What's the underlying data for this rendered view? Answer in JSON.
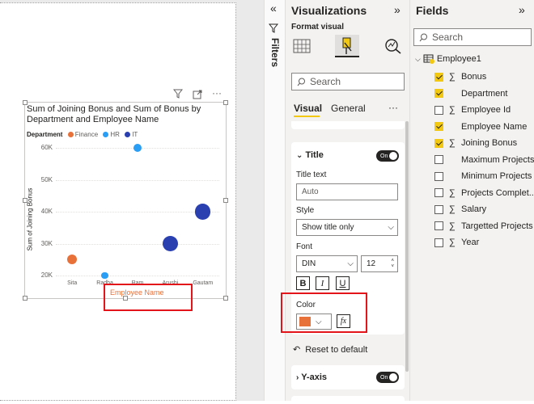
{
  "chart": {
    "title": "Sum of Joining Bonus and Sum of Bonus by Department and Employee Name",
    "legend_title": "Department",
    "legend": [
      {
        "name": "Finance",
        "color": "#e8713a"
      },
      {
        "name": "HR",
        "color": "#2a9df4"
      },
      {
        "name": "IT",
        "color": "#2a3fb0"
      }
    ],
    "y_title": "Sum of Joining Bonus",
    "x_title": "Employee Name",
    "y_ticks": [
      "60K",
      "50K",
      "40K",
      "30K",
      "20K"
    ],
    "x_ticks": [
      "Sita",
      "Radha",
      "Ram",
      "Arushi",
      "Gautam"
    ]
  },
  "chart_data": {
    "type": "scatter",
    "title": "Sum of Joining Bonus and Sum of Bonus by Department and Employee Name",
    "xlabel": "Employee Name",
    "ylabel": "Sum of Joining Bonus",
    "categories": [
      "Sita",
      "Radha",
      "Ram",
      "Arushi",
      "Gautam"
    ],
    "ylim": [
      20000,
      60000
    ],
    "series": [
      {
        "name": "Finance",
        "points": [
          {
            "x": "Sita",
            "y": 25000,
            "size": 1
          }
        ]
      },
      {
        "name": "HR",
        "points": [
          {
            "x": "Radha",
            "y": 20000,
            "size": 0.7
          },
          {
            "x": "Ram",
            "y": 60000,
            "size": 0.9
          }
        ]
      },
      {
        "name": "IT",
        "points": [
          {
            "x": "Arushi",
            "y": 30000,
            "size": 1.6
          },
          {
            "x": "Gautam",
            "y": 40000,
            "size": 1.6
          }
        ]
      }
    ]
  },
  "filters": {
    "label": "Filters",
    "icon": "chevron-left-icon"
  },
  "viz": {
    "title": "Visualizations",
    "subtitle": "Format visual",
    "search_placeholder": "Search",
    "tab_visual": "Visual",
    "tab_general": "General",
    "more": "···",
    "title_section": "Title",
    "toggle_on": "On",
    "title_text_label": "Title text",
    "title_text_value": "Auto",
    "style_label": "Style",
    "style_value": "Show title only",
    "font_label": "Font",
    "font_value": "DIN",
    "font_size": "12",
    "bold": "B",
    "italic": "I",
    "underline": "U",
    "color_label": "Color",
    "color_value": "#e8713a",
    "fx": "fx",
    "reset": "Reset to default",
    "yaxis": "Y-axis"
  },
  "fields": {
    "title": "Fields",
    "search_placeholder": "Search",
    "table": "Employee1",
    "items": [
      {
        "label": "Bonus",
        "checked": true,
        "sigma": true
      },
      {
        "label": "Department",
        "checked": true,
        "sigma": false
      },
      {
        "label": "Employee Id",
        "checked": false,
        "sigma": true
      },
      {
        "label": "Employee Name",
        "checked": true,
        "sigma": false
      },
      {
        "label": "Joining Bonus",
        "checked": true,
        "sigma": true
      },
      {
        "label": "Maximum Projects",
        "checked": false,
        "sigma": false
      },
      {
        "label": "Minimum Projects",
        "checked": false,
        "sigma": false
      },
      {
        "label": "Projects Complet...",
        "checked": false,
        "sigma": true
      },
      {
        "label": "Salary",
        "checked": false,
        "sigma": true
      },
      {
        "label": "Targetted Projects",
        "checked": false,
        "sigma": true
      },
      {
        "label": "Year",
        "checked": false,
        "sigma": true
      }
    ]
  }
}
